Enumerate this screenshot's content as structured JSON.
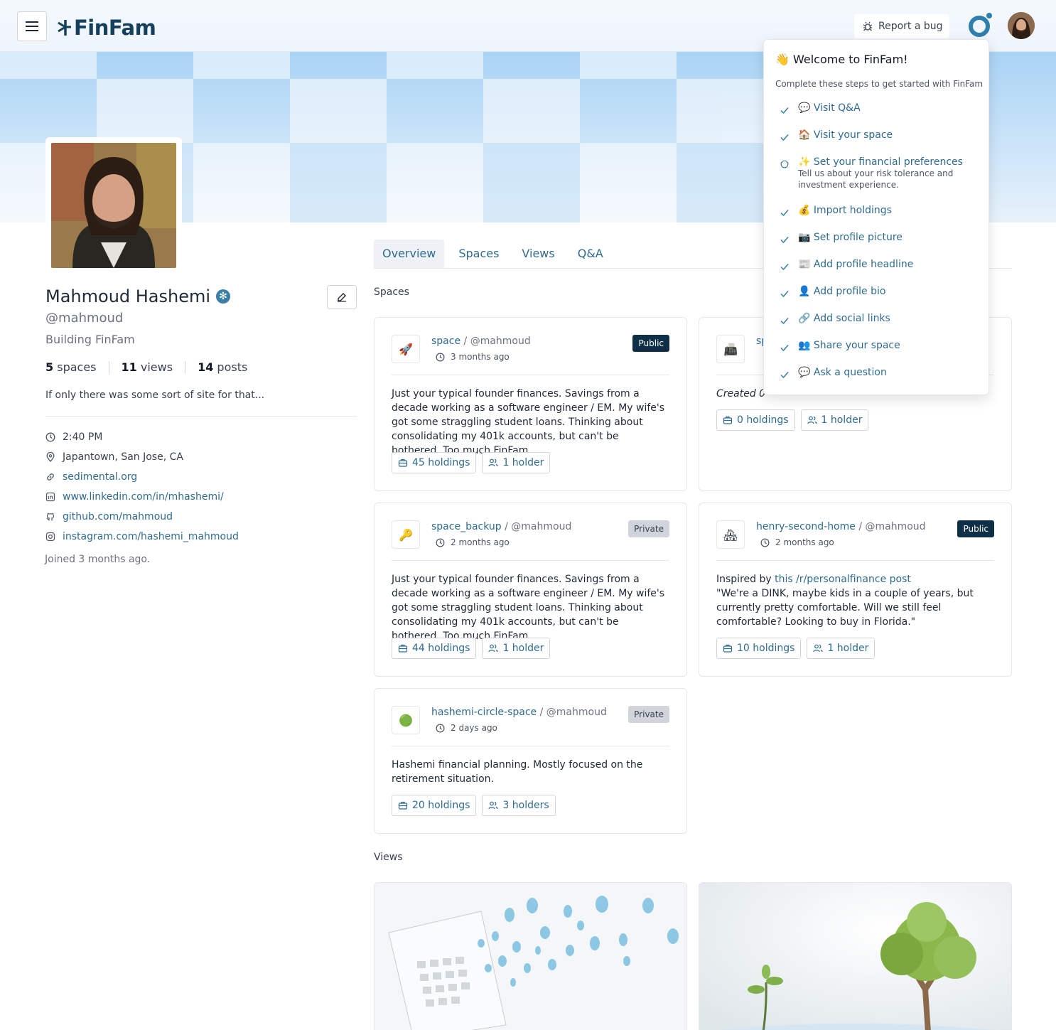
{
  "header": {
    "logo": "FinFam",
    "report_bug": "Report a bug"
  },
  "profile": {
    "name": "Mahmoud Hashemi",
    "handle": "@mahmoud",
    "headline": "Building FinFam",
    "stats": [
      {
        "count": "5",
        "label": "spaces"
      },
      {
        "count": "11",
        "label": "views"
      },
      {
        "count": "14",
        "label": "posts"
      }
    ],
    "bio": "If only there was some sort of site for that...",
    "info": {
      "time": "2:40 PM",
      "location": "Japantown, San Jose, CA",
      "website": "sedimental.org",
      "linkedin": "www.linkedin.com/in/mhashemi/",
      "github": "github.com/mahmoud",
      "instagram": "instagram.com/hashemi_mahmoud"
    },
    "joined": "Joined 3 months ago."
  },
  "tabs": [
    "Overview",
    "Spaces",
    "Views",
    "Q&A"
  ],
  "sections": {
    "spaces": "Spaces",
    "views": "Views"
  },
  "spaces": [
    {
      "icon": "🚀",
      "name": "space",
      "owner": " / @mahmoud",
      "ago": "3 months ago",
      "visibility": "Public",
      "description": "Just your typical founder finances. Savings from a decade working as a software engineer / EM. My wife's got some straggling student loans. Thinking about consolidating my 401k accounts, but can't be bothered. Too much FinFam...",
      "holdings": "45 holdings",
      "holders": "1 holder"
    },
    {
      "icon": "📠",
      "name": "sp",
      "created": "Created 0",
      "holdings": "0 holdings",
      "holders": "1 holder"
    },
    {
      "icon": "🔑",
      "name": "space_backup",
      "owner": " / @mahmoud",
      "ago": "2 months ago",
      "visibility": "Private",
      "description": "Just your typical founder finances. Savings from a decade working as a software engineer / EM. My wife's got some straggling student loans. Thinking about consolidating my 401k accounts, but can't be bothered. Too much FinFam...",
      "holdings": "44 holdings",
      "holders": "1 holder"
    },
    {
      "icon": "🏘",
      "name": "henry-second-home",
      "owner": " / @mahmoud",
      "ago": "2 months ago",
      "visibility": "Public",
      "description_prefix": "Inspired by ",
      "description_link": "this /r/personalfinance post",
      "description_quote": "\"We're a DINK, maybe kids in a couple of years, but currently pretty comfortable. Will we still feel comfortable? Looking to buy in Florida.\"",
      "holdings": "10 holdings",
      "holders": "1 holder"
    },
    {
      "icon": "🟢",
      "name": "hashemi-circle-space",
      "owner": " / @mahmoud",
      "ago": "2 days ago",
      "visibility": "Private",
      "description": "Hashemi financial planning. Mostly focused on the retirement situation.",
      "holdings": "20 holdings",
      "holders": "3 holders"
    }
  ],
  "onboarding": {
    "title": "👋 Welcome to FinFam!",
    "subtitle": "Complete these steps to get started with FinFam",
    "steps": [
      {
        "label": "💬 Visit Q&A",
        "done": true
      },
      {
        "label": "🏠 Visit your space",
        "done": true
      },
      {
        "label": "✨ Set your financial preferences",
        "sub": "Tell us about your risk tolerance and investment experience.",
        "done": false
      },
      {
        "label": "💰 Import holdings",
        "done": true
      },
      {
        "label": "📷 Set profile picture",
        "done": true
      },
      {
        "label": "📰 Add profile headline",
        "done": true
      },
      {
        "label": "👤 Add profile bio",
        "done": true
      },
      {
        "label": "🔗 Add social links",
        "done": true
      },
      {
        "label": "👥 Share your space",
        "done": true
      },
      {
        "label": "💬 Ask a question",
        "done": true
      }
    ]
  },
  "colors": {
    "brand": "#14405c",
    "link": "#2f6b8f",
    "accent": "#3b7fa6",
    "public_badge": "#0f2f47",
    "private_badge": "#d1d5db"
  }
}
